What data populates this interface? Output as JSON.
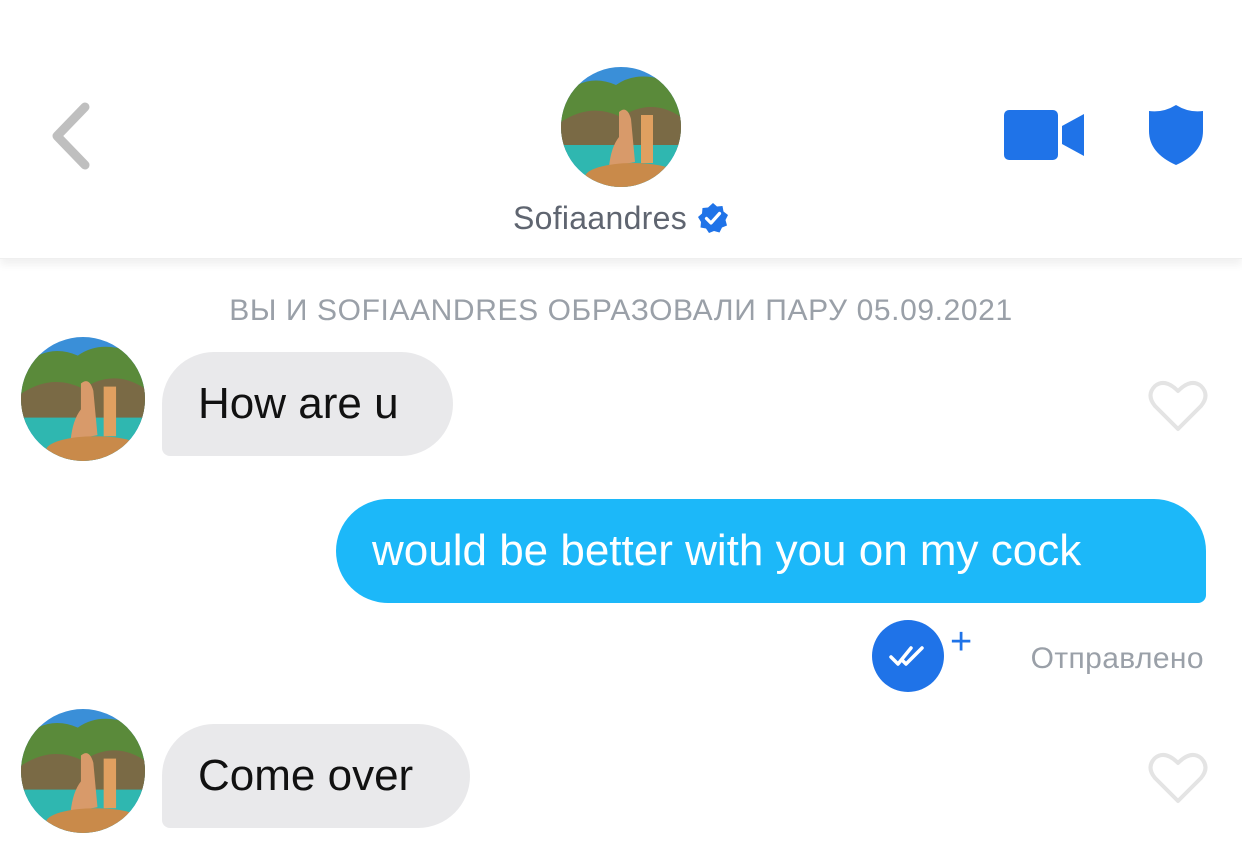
{
  "header": {
    "match_name": "Sofiaandres",
    "icons": {
      "back": "chevron-left-icon",
      "verified": "verified-badge-icon",
      "video": "video-camera-icon",
      "safety": "shield-icon"
    }
  },
  "match_note": "ВЫ И SOFIAANDRES ОБРАЗОВАЛИ ПАРУ 05.09.2021",
  "messages": [
    {
      "direction": "incoming",
      "text": "How are u"
    },
    {
      "direction": "outgoing",
      "text": "would be better with you on my cock"
    },
    {
      "direction": "incoming",
      "text": "Come over"
    }
  ],
  "delivery": {
    "status_label": "Отправлено",
    "plus_label": "+"
  },
  "colors": {
    "accent_blue": "#1f73e8",
    "outgoing_bubble": "#1cb8f9",
    "incoming_bubble": "#e9e9eb",
    "muted_text": "#9aa0a8"
  }
}
